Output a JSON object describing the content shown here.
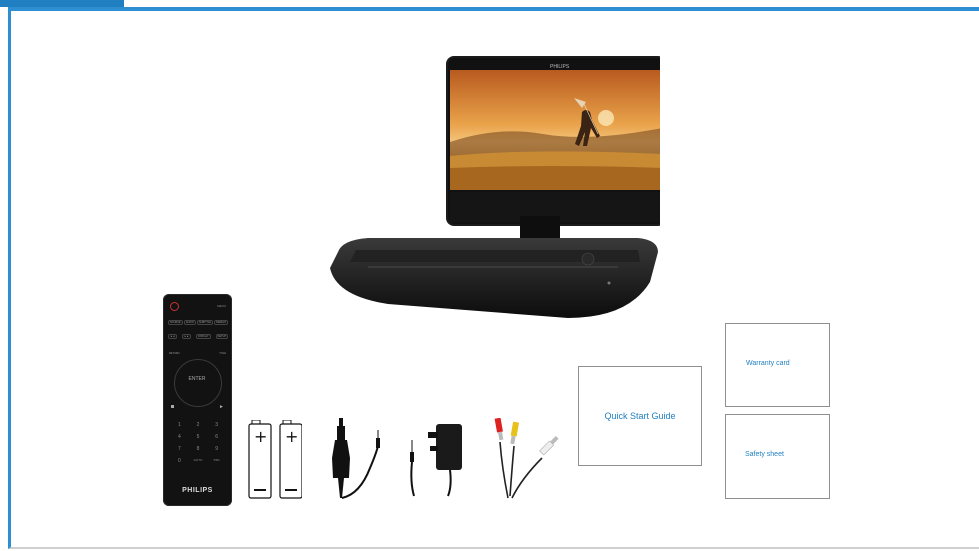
{
  "brand": "PHILIPS",
  "remote": {
    "top_label": "MENU",
    "row1": [
      "SOURCE",
      "AUDIO",
      "SUBTITLE",
      "REPEAT"
    ],
    "row2": [
      "◄◄",
      "►►",
      "DISPLAY",
      "SETUP"
    ],
    "left_key": "RETURN",
    "right_key": "TITLE",
    "enter": "ENTER",
    "digits": [
      "1",
      "2",
      "3",
      "4",
      "5",
      "6",
      "7",
      "8",
      "9",
      "0"
    ],
    "bottom_keys": [
      "GOTO",
      "PBC"
    ]
  },
  "cards": {
    "quick_start": "Quick Start Guide",
    "warranty": "Warranty card",
    "safety": "Safety sheet"
  },
  "colors": {
    "accent": "#1f7fc1",
    "border": "#2d8ed1"
  }
}
